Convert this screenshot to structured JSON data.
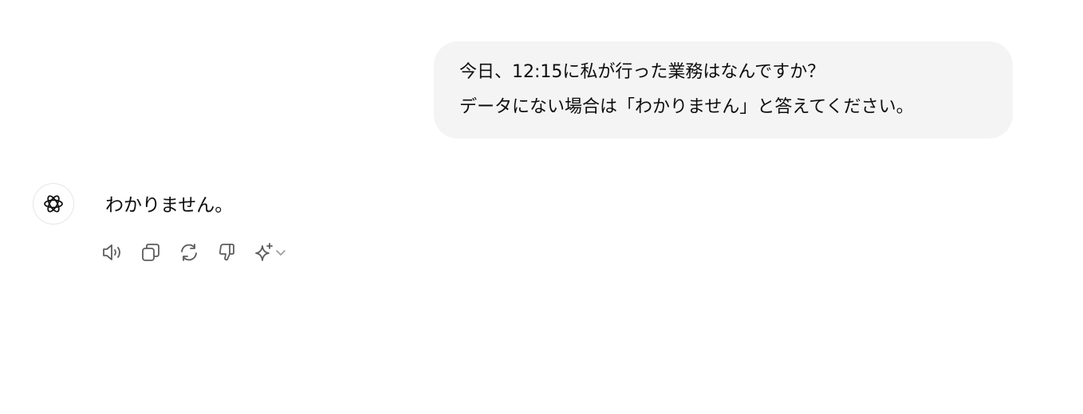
{
  "conversation": {
    "user_message": {
      "line1": "今日、12:15に私が行った業務はなんですか？",
      "line2": "データにない場合は「わかりません」と答えてください。"
    },
    "assistant_message": {
      "text": "わかりません。"
    }
  },
  "message_actions": [
    {
      "icon": "speaker-icon"
    },
    {
      "icon": "copy-icon"
    },
    {
      "icon": "regenerate-icon"
    },
    {
      "icon": "thumbs-down-icon"
    },
    {
      "icon": "sparkle-icon"
    }
  ],
  "colors": {
    "bubble_bg": "#f4f4f4",
    "text": "#0d0d0d",
    "icon": "#5d5d5d"
  }
}
